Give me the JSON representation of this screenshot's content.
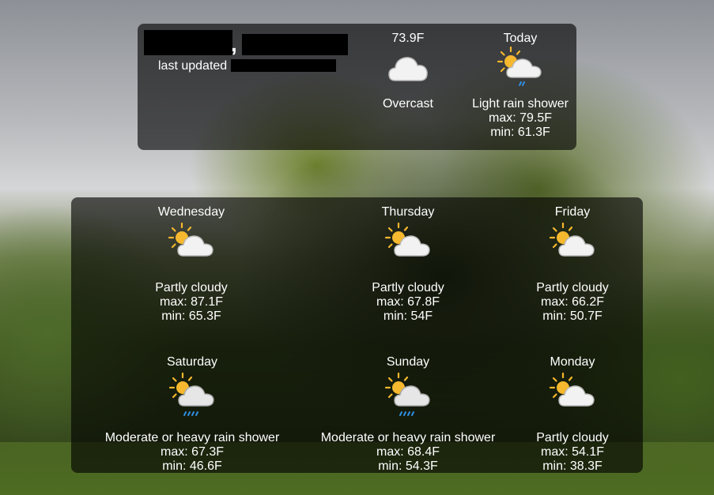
{
  "location": {
    "last_updated_label": "last updated"
  },
  "current": {
    "temperature": "73.9F",
    "condition": "Overcast",
    "icon": "cloud-icon"
  },
  "today": {
    "label": "Today",
    "condition": "Light rain shower",
    "max": "max: 79.5F",
    "min": "min: 61.3F",
    "icon": "sun-cloud-light-rain-icon"
  },
  "forecast": [
    {
      "day": "Wednesday",
      "condition": "Partly cloudy",
      "max": "max: 87.1F",
      "min": "min: 65.3F",
      "icon": "sun-cloud-icon"
    },
    {
      "day": "Thursday",
      "condition": "Partly cloudy",
      "max": "max: 67.8F",
      "min": "min: 54F",
      "icon": "sun-cloud-icon"
    },
    {
      "day": "Friday",
      "condition": "Partly cloudy",
      "max": "max: 66.2F",
      "min": "min: 50.7F",
      "icon": "sun-cloud-icon"
    },
    {
      "day": "Saturday",
      "condition": "Moderate or heavy rain shower",
      "max": "max: 67.3F",
      "min": "min: 46.6F",
      "icon": "sun-cloud-heavy-rain-icon"
    },
    {
      "day": "Sunday",
      "condition": "Moderate or heavy rain shower",
      "max": "max: 68.4F",
      "min": "min: 54.3F",
      "icon": "sun-cloud-heavy-rain-icon"
    },
    {
      "day": "Monday",
      "condition": "Partly cloudy",
      "max": "max: 54.1F",
      "min": "min: 38.3F",
      "icon": "sun-cloud-icon"
    }
  ],
  "colors": {
    "panel": "#000000",
    "sun": "#f5b82e",
    "rain": "#2f8fe0",
    "cloud": "#f2f2f2"
  }
}
